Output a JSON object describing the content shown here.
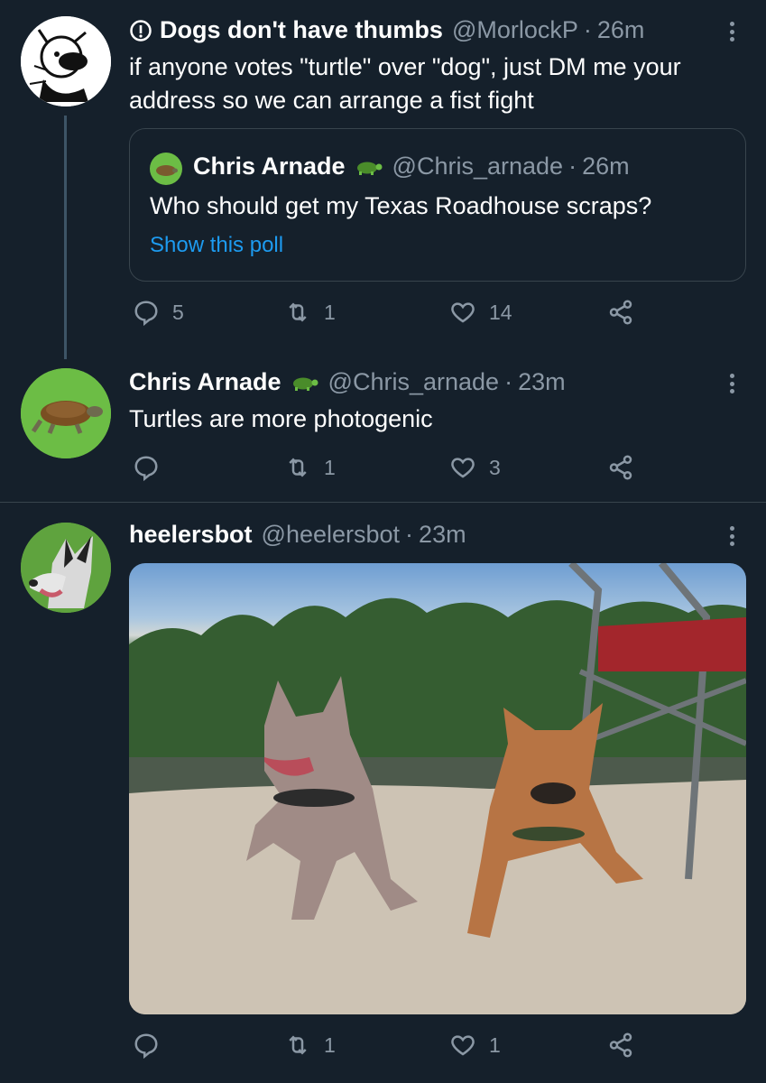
{
  "tweets": [
    {
      "info_icon": "info-circle-icon",
      "name": "Dogs don't have thumbs",
      "handle": "@MorlockP",
      "dot": "·",
      "time": "26m",
      "text": "if anyone votes \"turtle\" over \"dog\", just DM me your address so we can arrange a fist fight",
      "quote": {
        "name": "Chris Arnade",
        "badge": "turtle-emoji",
        "handle": "@Chris_arnade",
        "dot": "·",
        "time": "26m",
        "text": "Who should get my Texas Roadhouse scraps?",
        "link": "Show this poll"
      },
      "replies": "5",
      "retweets": "1",
      "likes": "14"
    },
    {
      "name": "Chris Arnade",
      "badge": "turtle-emoji",
      "handle": "@Chris_arnade",
      "dot": "·",
      "time": "23m",
      "text": "Turtles are more photogenic",
      "replies": "",
      "retweets": "1",
      "likes": "3"
    },
    {
      "name": "heelersbot",
      "handle": "@heelersbot",
      "dot": "·",
      "time": "23m",
      "media": "photo of two dogs lying on sand",
      "replies": "",
      "retweets": "1",
      "likes": "1"
    }
  ],
  "colors": {
    "background": "#15202b",
    "secondary_text": "#8b98a5",
    "link": "#1d9bf0",
    "border": "#38444d"
  }
}
